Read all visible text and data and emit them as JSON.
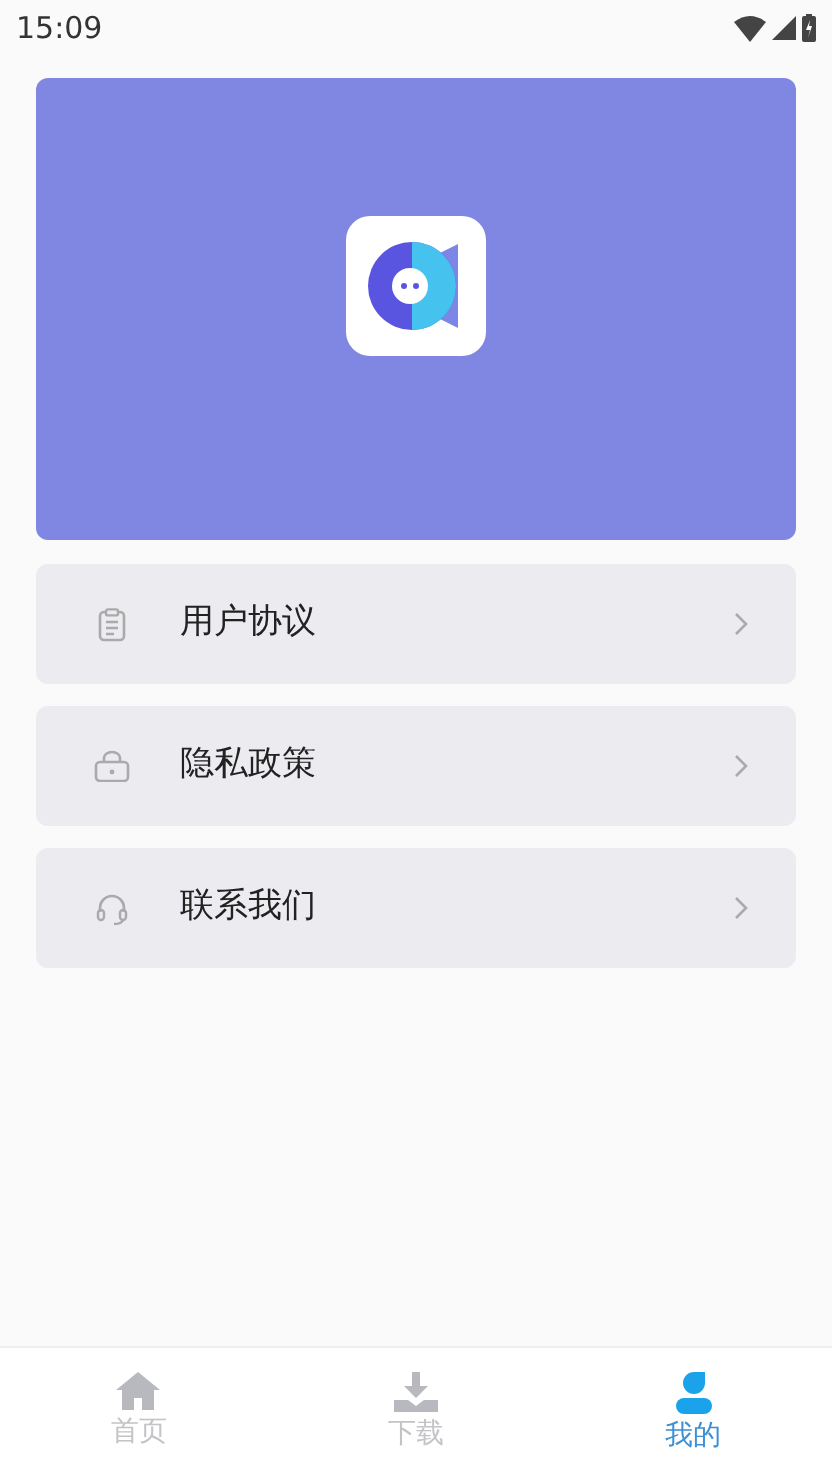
{
  "status_bar": {
    "time": "15:09"
  },
  "menu": [
    {
      "kind": "document",
      "label": "用户协议"
    },
    {
      "kind": "lock",
      "label": "隐私政策"
    },
    {
      "kind": "headset",
      "label": "联系我们"
    }
  ],
  "tabs": [
    {
      "kind": "home",
      "label": "首页",
      "selected": false
    },
    {
      "kind": "download",
      "label": "下载",
      "selected": false
    },
    {
      "kind": "person",
      "label": "我的",
      "selected": true
    }
  ]
}
